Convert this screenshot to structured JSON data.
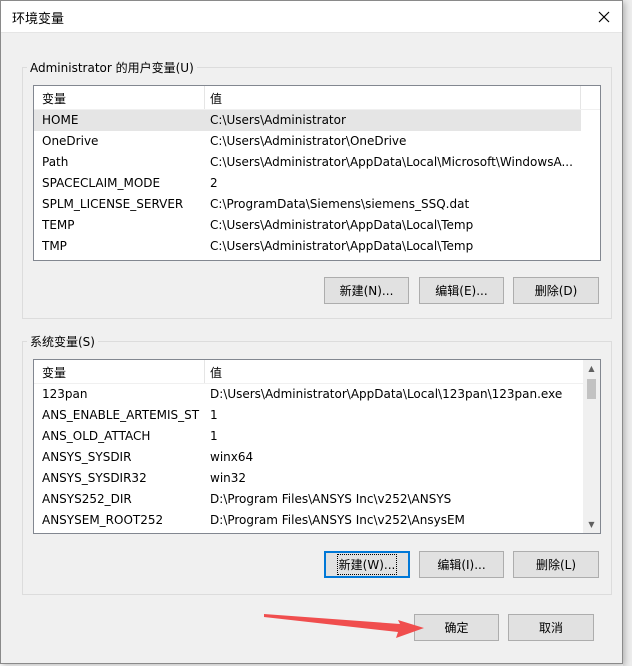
{
  "window": {
    "title": "环境变量"
  },
  "user_vars": {
    "group_label": "Administrator 的用户变量(U)",
    "columns": [
      "变量",
      "值"
    ],
    "rows": [
      {
        "name": "HOME",
        "value": "C:\\Users\\Administrator",
        "selected": true
      },
      {
        "name": "OneDrive",
        "value": "C:\\Users\\Administrator\\OneDrive"
      },
      {
        "name": "Path",
        "value": "C:\\Users\\Administrator\\AppData\\Local\\Microsoft\\WindowsA..."
      },
      {
        "name": "SPACECLAIM_MODE",
        "value": "2"
      },
      {
        "name": "SPLM_LICENSE_SERVER",
        "value": "C:\\ProgramData\\Siemens\\siemens_SSQ.dat"
      },
      {
        "name": "TEMP",
        "value": "C:\\Users\\Administrator\\AppData\\Local\\Temp"
      },
      {
        "name": "TMP",
        "value": "C:\\Users\\Administrator\\AppData\\Local\\Temp"
      }
    ],
    "buttons": {
      "new": "新建(N)...",
      "edit": "编辑(E)...",
      "delete": "删除(D)"
    }
  },
  "system_vars": {
    "group_label": "系统变量(S)",
    "columns": [
      "变量",
      "值"
    ],
    "rows": [
      {
        "name": "123pan",
        "value": "D:\\Users\\Administrator\\AppData\\Local\\123pan\\123pan.exe"
      },
      {
        "name": "ANS_ENABLE_ARTEMIS_ST",
        "value": "1"
      },
      {
        "name": "ANS_OLD_ATTACH",
        "value": "1"
      },
      {
        "name": "ANSYS_SYSDIR",
        "value": "winx64"
      },
      {
        "name": "ANSYS_SYSDIR32",
        "value": "win32"
      },
      {
        "name": "ANSYS252_DIR",
        "value": "D:\\Program Files\\ANSYS Inc\\v252\\ANSYS"
      },
      {
        "name": "ANSYSEM_ROOT252",
        "value": "D:\\Program Files\\ANSYS Inc\\v252\\AnsysEM"
      }
    ],
    "buttons": {
      "new": "新建(W)...",
      "edit": "编辑(I)...",
      "delete": "删除(L)"
    }
  },
  "footer": {
    "ok": "确定",
    "cancel": "取消"
  },
  "colors": {
    "arrow": "#f04e4e",
    "focus": "#0078d7",
    "selection": "#e5e5e5"
  }
}
